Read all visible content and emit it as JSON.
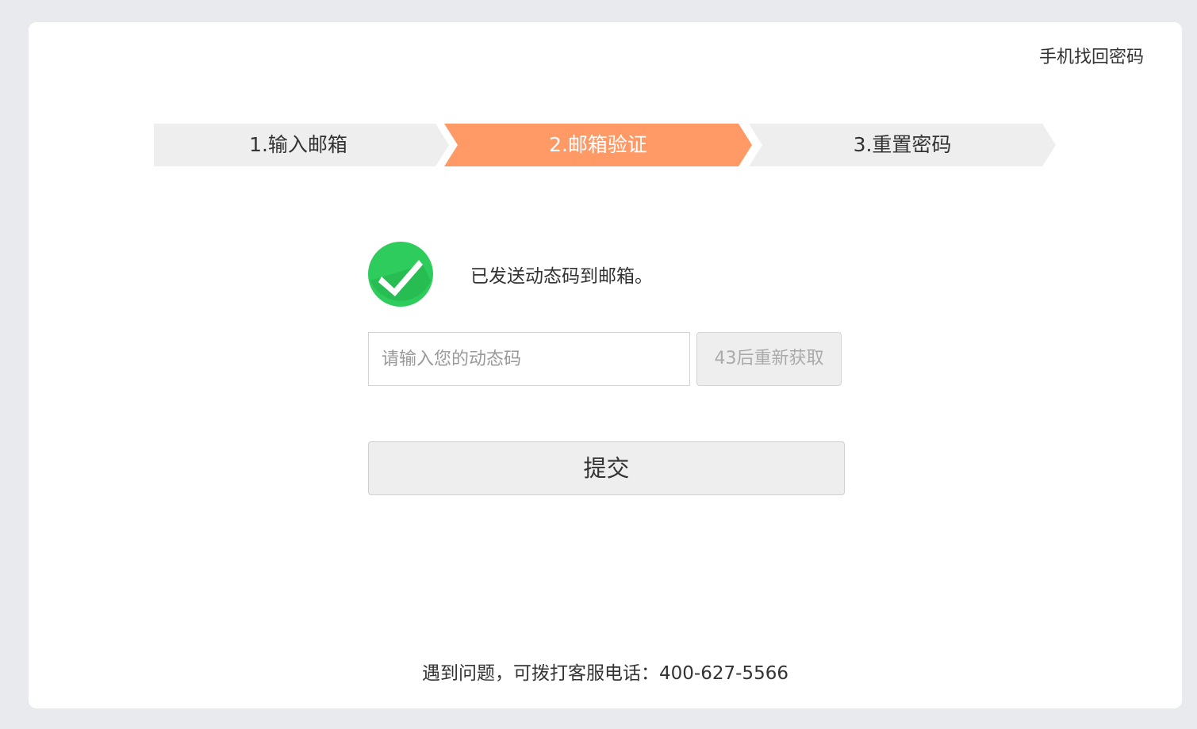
{
  "header": {
    "phone_recovery_link": "手机找回密码"
  },
  "steps": [
    {
      "label": "1.输入邮箱",
      "state": "done"
    },
    {
      "label": "2.邮箱验证",
      "state": "active"
    },
    {
      "label": "3.重置密码",
      "state": "pending"
    }
  ],
  "status": {
    "icon": "check-circle-icon",
    "message": "已发送动态码到邮箱。"
  },
  "code_form": {
    "input_placeholder": "请输入您的动态码",
    "input_value": "",
    "resend_label": "43后重新获取",
    "submit_label": "提交"
  },
  "footer": {
    "help_text": "遇到问题，可拨打客服电话：400-627-5566"
  },
  "colors": {
    "page_bg": "#e9eaee",
    "card_bg": "#ffffff",
    "step_active": "#ff9966",
    "step_inactive": "#eeeeee",
    "check_green": "#2ecc5c"
  }
}
